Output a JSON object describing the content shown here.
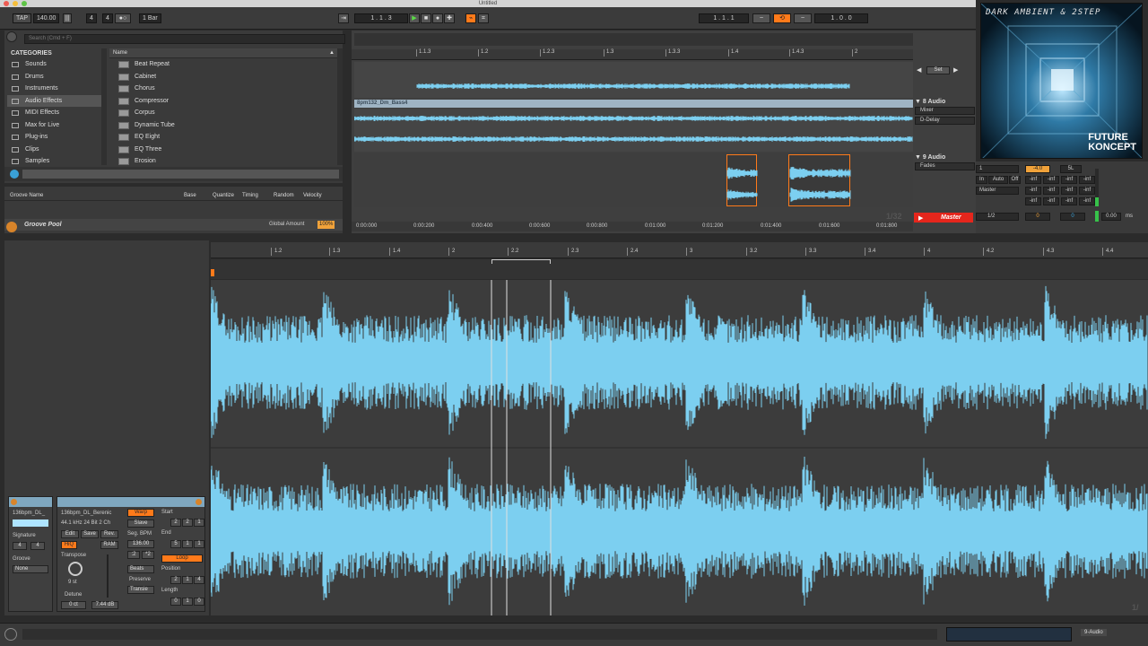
{
  "window": {
    "title": "Untitled"
  },
  "transport": {
    "tap": "TAP",
    "tempo": "140.00",
    "sig_num": "4",
    "sig_den": "4",
    "quantize": "1 Bar",
    "arrangement_pos": "1 . 1 . 3",
    "loop_start": "1 . 1 . 1",
    "loop_length": "1 . 0 . 0"
  },
  "browser": {
    "search_placeholder": "Search (Cmd + F)",
    "categories_header": "CATEGORIES",
    "categories": [
      {
        "label": "Sounds",
        "icon": "note-icon"
      },
      {
        "label": "Drums",
        "icon": "drum-icon"
      },
      {
        "label": "Instruments",
        "icon": "instrument-icon"
      },
      {
        "label": "Audio Effects",
        "icon": "audio-effects-icon"
      },
      {
        "label": "MIDI Effects",
        "icon": "midi-effects-icon"
      },
      {
        "label": "Max for Live",
        "icon": "max-icon"
      },
      {
        "label": "Plug-ins",
        "icon": "plugin-icon"
      },
      {
        "label": "Clips",
        "icon": "clip-icon"
      },
      {
        "label": "Samples",
        "icon": "sample-icon"
      }
    ],
    "name_header": "Name",
    "items": [
      "Beat Repeat",
      "Cabinet",
      "Chorus",
      "Compressor",
      "Corpus",
      "Dynamic Tube",
      "EQ Eight",
      "EQ Three",
      "Erosion"
    ]
  },
  "groove": {
    "col_name": "Groove Name",
    "col_base": "Base",
    "col_quantize": "Quantize",
    "col_timing": "Timing",
    "col_random": "Random",
    "col_velocity": "Velocity",
    "pool_label": "Groove Pool",
    "global_amount_label": "Global Amount",
    "global_amount": "100%"
  },
  "arrangement": {
    "ruler": [
      "1.1.3",
      "1.2",
      "1.2.3",
      "1.3",
      "1.3.3",
      "1.4",
      "1.4.3",
      "2"
    ],
    "clip_name": "8pm132_Dm_Bass4",
    "set_label": "Set",
    "tracks": [
      {
        "title": "8 Audio",
        "dd1": "Mixer",
        "dd2": "D-Delay"
      },
      {
        "title": "9 Audio",
        "dd1": "Fades"
      }
    ],
    "timeline": [
      "0:00:000",
      "0:00:200",
      "0:00:400",
      "0:00:600",
      "0:00:800",
      "0:01:000",
      "0:01:200",
      "0:01:400",
      "0:01:600",
      "0:01:800"
    ],
    "zoom": "1/32",
    "master": "Master"
  },
  "mixer": {
    "track_num": "1",
    "vol": "-4.0",
    "pan": "5L",
    "in": "In",
    "auto": "Auto",
    "off": "Off",
    "master": "Master",
    "inf": "-inf",
    "master_num": "1/2",
    "master_vol": "0",
    "master_pan": "0",
    "cue": "0.00",
    "ms": "ms"
  },
  "album": {
    "title": "DARK AMBIENT & 2STEP",
    "brand1": "FUTURE",
    "brand2": "KONCEPT"
  },
  "detail": {
    "ruler": [
      "1.2",
      "1.3",
      "1.4",
      "2",
      "2.2",
      "2.3",
      "2.4",
      "3",
      "3.2",
      "3.3",
      "3.4",
      "4",
      "4.2",
      "4.3",
      "4.4"
    ],
    "clip_name": "136bpm_DL_",
    "sample_name": "136bpm_DL_Berenic",
    "sample_info": "44.1 kHz 24 Bit 2 Ch",
    "edit": "Edit",
    "save": "Save",
    "rev": "Rev.",
    "hiq": "HiQ",
    "ram": "RAM",
    "signature": "Signature",
    "sig_num": "4",
    "sig_den": "4",
    "groove": "Groove",
    "groove_val": "None",
    "warp": "Warp",
    "slave": "Slave",
    "seg_bpm_label": "Seg. BPM",
    "seg_bpm": "136.00",
    "half": ":2",
    "double": "*2",
    "beats": "Beats",
    "preserve": "Preserve",
    "transient": "Transie",
    "transpose": "Transpose",
    "semis": "9 st",
    "detune": "Detune",
    "detune_val": "0 ct",
    "gain": "7.44 dB",
    "start": "Start",
    "start_val": [
      "2",
      "2",
      "1"
    ],
    "end": "End",
    "end_val": [
      "5",
      "1",
      "1"
    ],
    "loop": "Loop",
    "position": "Position",
    "pos_val": [
      "2",
      "1",
      "4"
    ],
    "length": "Length",
    "len_val": [
      "0",
      "1",
      "0"
    ],
    "zoom_right": "1/"
  },
  "bottom": {
    "track_label": "9-Audio"
  },
  "colors": {
    "wave": "#7ccff0",
    "accent": "#ff7a1a",
    "master": "#e5261c"
  }
}
